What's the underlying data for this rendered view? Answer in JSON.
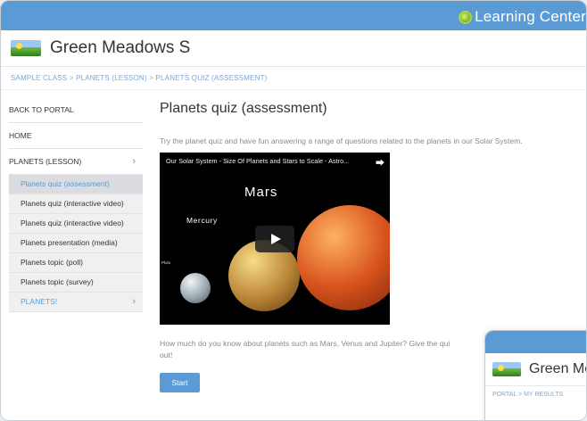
{
  "header": {
    "brand": "Learning Center",
    "brand_icon": "flower-icon",
    "bar_color": "#5b9bd5"
  },
  "school": {
    "name": "Green Meadows S",
    "logo_icon": "meadow-logo"
  },
  "breadcrumb": {
    "items": [
      "SAMPLE CLASS",
      "PLANETS (LESSON)",
      "PLANETS QUIZ (ASSESSMENT)"
    ],
    "separator": ">"
  },
  "sidebar": {
    "back": "BACK TO PORTAL",
    "home": "HOME",
    "lesson": "PLANETS (LESSON)",
    "lesson_chevron": "›",
    "items": [
      {
        "label": "Planets quiz (assessment)"
      },
      {
        "label": "Planets quiz (interactive video)"
      },
      {
        "label": "Planets quiz (interactive video)"
      },
      {
        "label": "Planets presentation (media)"
      },
      {
        "label": "Planets topic (poll)"
      },
      {
        "label": "Planets topic (survey)"
      },
      {
        "label": "PLANETS!"
      }
    ]
  },
  "main": {
    "title": "Planets quiz (assessment)",
    "intro": "Try the planet quiz and have fun answering a range of questions related to the planets in our Solar System.",
    "video": {
      "title": "Our Solar System - Size Of Planets and Stars to Scale - Astro...",
      "mars_label": "Mars",
      "mercury_label": "Mercury",
      "pluto_label": "Pluto"
    },
    "body": "How much do you know about planets such as Mars, Venus and Jupiter? Give the qui",
    "body_end": "out!",
    "start_label": "Start"
  },
  "popup": {
    "school_name": "Green Me",
    "breadcrumb": "PORTAL > MY RESULTS"
  }
}
